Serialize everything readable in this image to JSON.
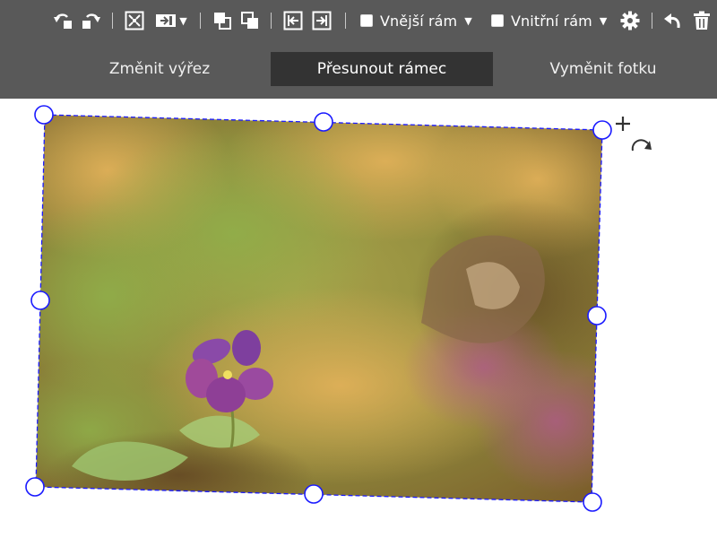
{
  "toolbar": {
    "outer_frame_label": "Vnější rám",
    "inner_frame_label": "Vnitřní rám",
    "outer_frame_checked": false,
    "inner_frame_checked": false,
    "icons": [
      "rotate-left-icon",
      "rotate-right-icon",
      "fit-icon",
      "align-dropdown-icon",
      "bring-forward-icon",
      "send-backward-icon",
      "move-left-icon",
      "move-right-icon",
      "settings-icon",
      "undo-icon",
      "delete-icon"
    ]
  },
  "tabs": [
    {
      "label": "Změnit výřez",
      "active": false
    },
    {
      "label": "Přesunout rámec",
      "active": true
    },
    {
      "label": "Vyměnit fotku",
      "active": false
    }
  ],
  "colors": {
    "toolbar_bg": "#595959",
    "active_tab_bg": "#333333",
    "handle_stroke": "#1a1aff",
    "selection_dash": "#1a1aff"
  }
}
